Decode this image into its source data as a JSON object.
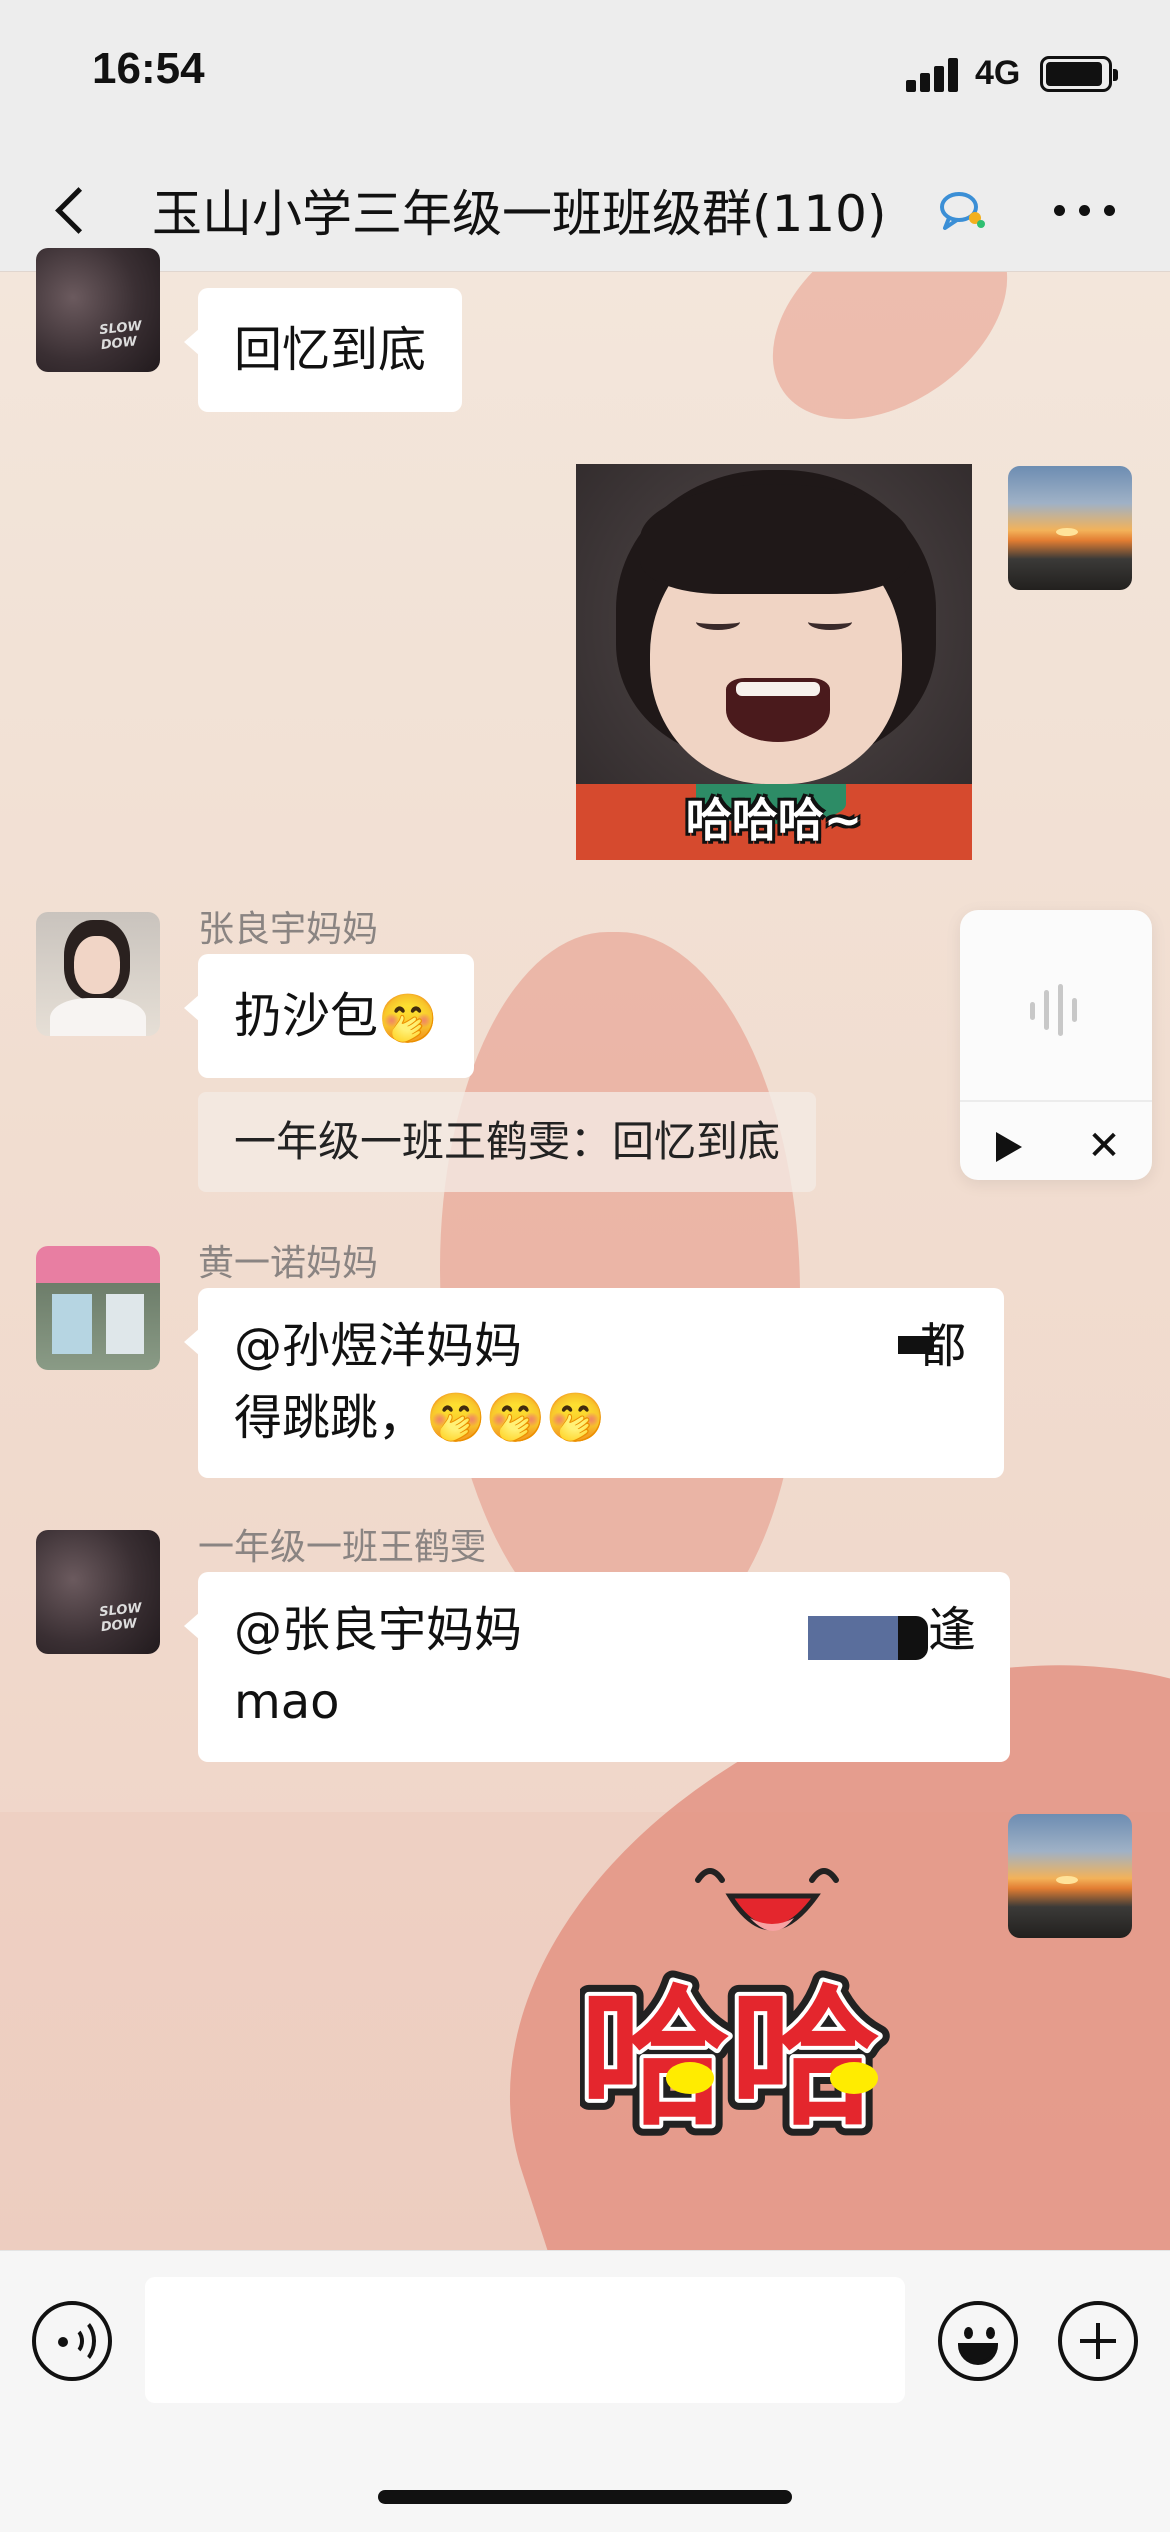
{
  "status_bar": {
    "time": "16:54",
    "network": "4G"
  },
  "header": {
    "title": "玉山小学三年级一班班级群(110)",
    "back_icon": "chevron-left-icon",
    "chat_icon": "group-chat-icon",
    "more_icon": "more-dots-icon"
  },
  "messages": [
    {
      "sender": "",
      "text": "回忆到底",
      "side": "left",
      "avatar": "dark-photo"
    },
    {
      "sender": "",
      "type": "sticker",
      "caption": "哈哈哈~",
      "side": "right",
      "avatar": "sunset"
    },
    {
      "sender": "张良宇妈妈",
      "text": "扔沙包",
      "emoji": "🤭",
      "quote": "一年级一班王鹤雯：回忆到底",
      "side": "left",
      "avatar": "woman"
    },
    {
      "sender": "黄一诺妈妈",
      "lines": [
        "@孙煜洋妈妈",
        "得跳跳，🤭🤭🤭"
      ],
      "side": "left",
      "avatar": "shop"
    },
    {
      "sender": "一年级一班王鹤雯",
      "lines": [
        "@张良宇妈妈",
        "mao"
      ],
      "side": "left",
      "avatar": "dark-photo"
    },
    {
      "sender": "",
      "type": "sticker",
      "caption": "哈哈",
      "side": "right",
      "avatar": "sunset"
    }
  ],
  "voice_panel": {
    "wave_icon": "voice-wave-icon",
    "play_icon": "play-icon",
    "close_icon": "close-icon"
  },
  "partial_text": {
    "msg4_end": "都",
    "msg5_end": "逢"
  },
  "input_bar": {
    "placeholder": "",
    "icons": [
      "voice-icon",
      "emoji-icon",
      "plus-icon"
    ]
  },
  "colors": {
    "bubble": "#ffffff",
    "sticker_red": "#e4262d",
    "sticker_yellow": "#ffec00",
    "background": "#f2e3d7"
  }
}
